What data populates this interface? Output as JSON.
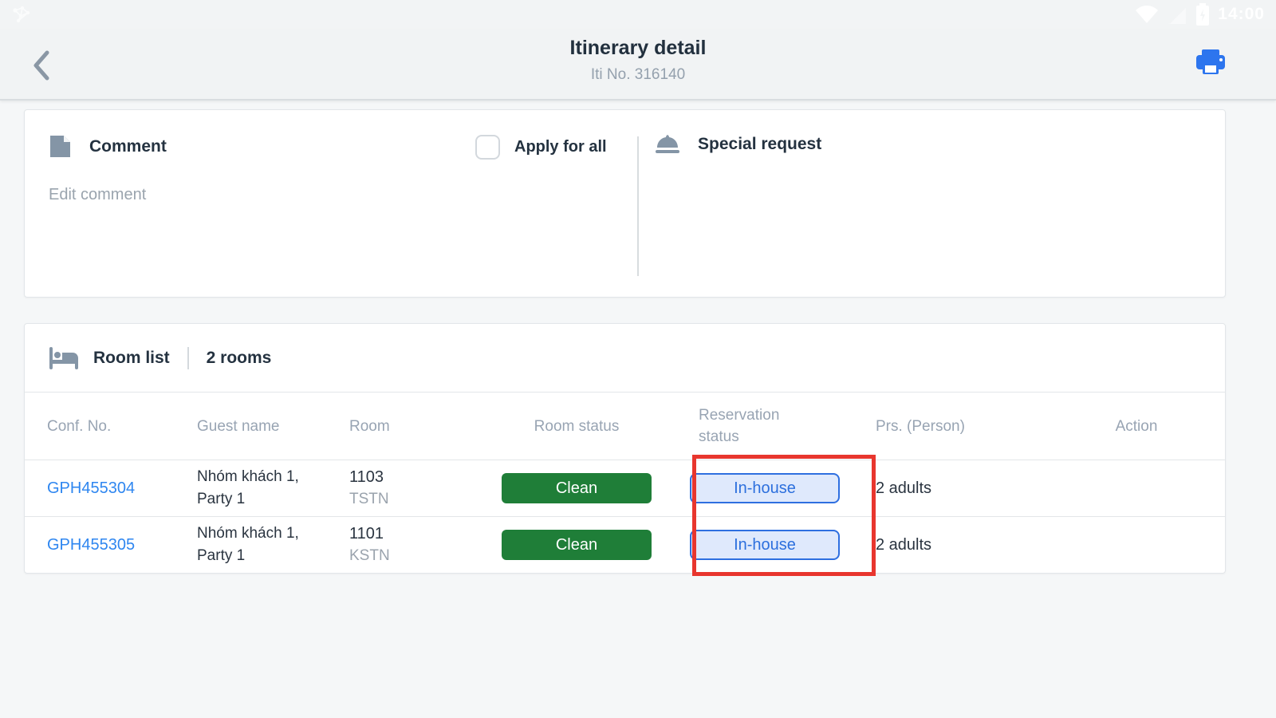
{
  "status_bar": {
    "time": "14:00"
  },
  "header": {
    "title": "Itinerary detail",
    "subtitle": "Iti No. 316140"
  },
  "comment_card": {
    "title": "Comment",
    "apply_label": "Apply for all",
    "placeholder": "Edit comment",
    "special_request_title": "Special request"
  },
  "room_list": {
    "title": "Room list",
    "count": "2 rooms",
    "columns": {
      "conf": "Conf. No.",
      "guest": "Guest name",
      "room": "Room",
      "room_status": "Room status",
      "reservation_status": "Reservation status",
      "persons": "Prs. (Person)",
      "action": "Action"
    },
    "rows": [
      {
        "conf_no": "GPH455304",
        "guest_name": "Nhóm khách 1, Party 1",
        "room": "1103",
        "room_code": "TSTN",
        "room_status": "Clean",
        "reservation_status": "In-house",
        "persons": "2 adults"
      },
      {
        "conf_no": "GPH455305",
        "guest_name": "Nhóm khách 1, Party 1",
        "room": "1101",
        "room_code": "KSTN",
        "room_status": "Clean",
        "reservation_status": "In-house",
        "persons": "2 adults"
      }
    ]
  },
  "colors": {
    "accent_blue": "#2e78ee",
    "link_blue": "#2e86f0",
    "clean_green": "#1f7e38",
    "inhouse_bg": "#dfe9fc",
    "inhouse_border": "#2e6fe0",
    "annotation_red": "#e8362e",
    "icon_gray": "#8495a6"
  }
}
